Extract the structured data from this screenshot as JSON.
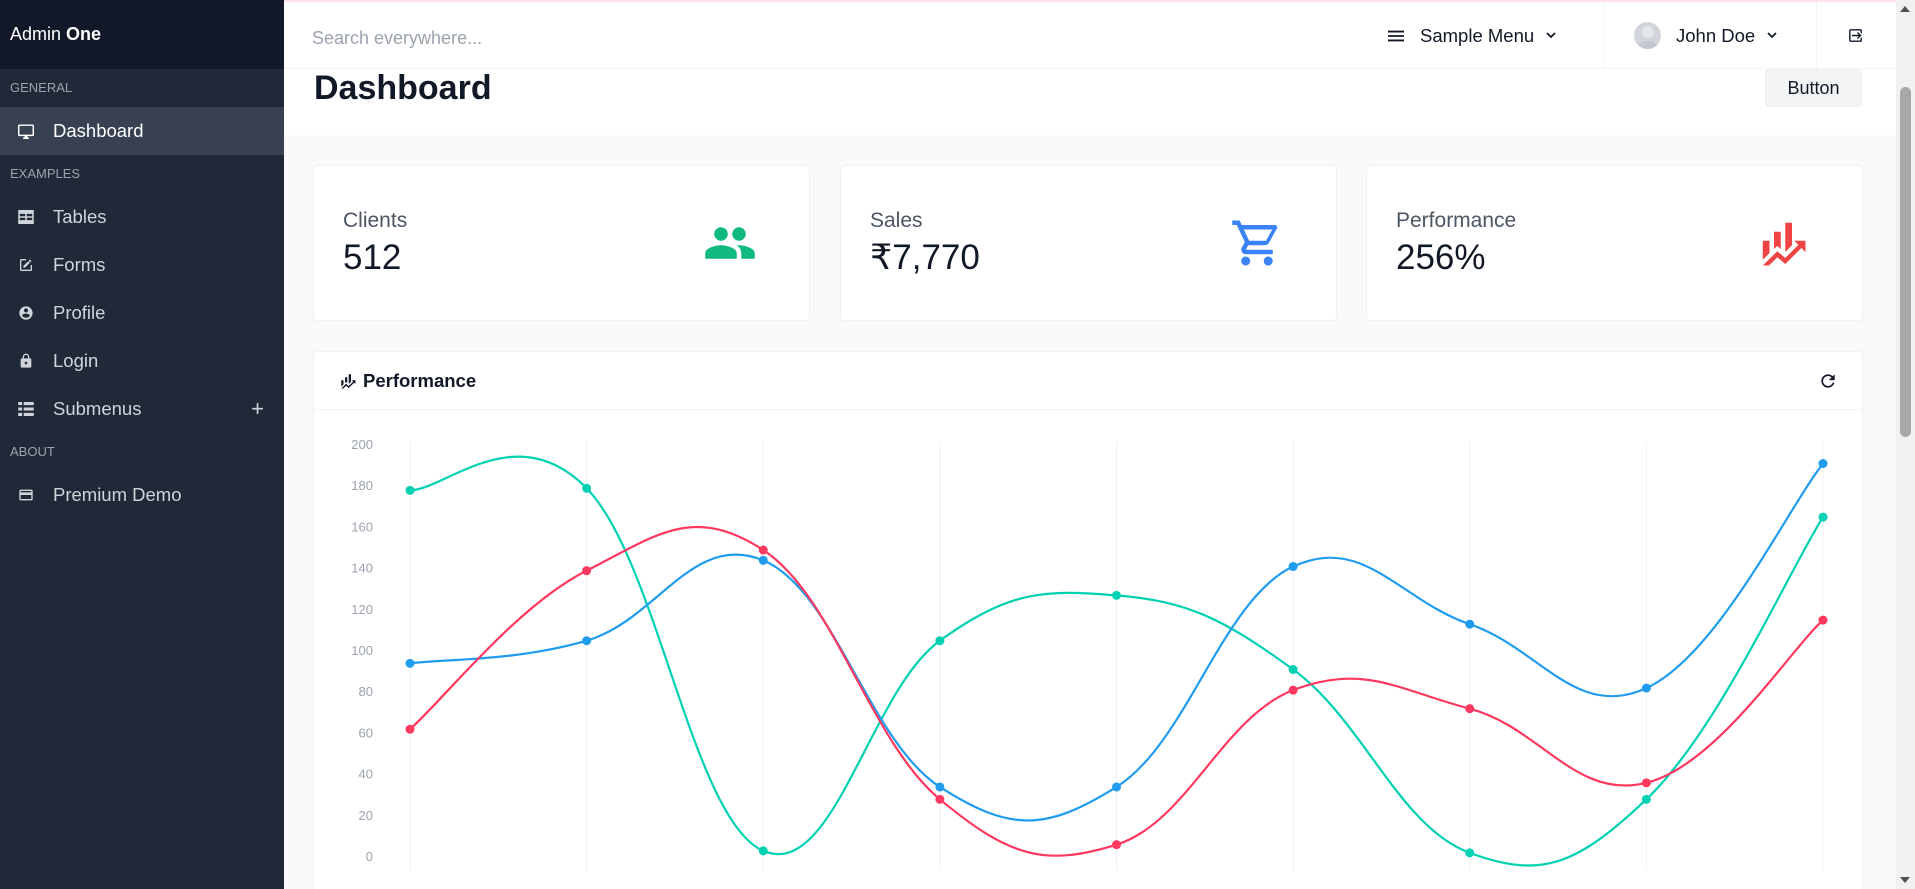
{
  "sidebar": {
    "brand_prefix": "Admin",
    "brand_bold": "One",
    "sections": [
      {
        "label": "GENERAL",
        "items": [
          {
            "label": "Dashboard",
            "icon": "monitor-icon",
            "active": true
          }
        ]
      },
      {
        "label": "EXAMPLES",
        "items": [
          {
            "label": "Tables",
            "icon": "table-icon"
          },
          {
            "label": "Forms",
            "icon": "edit-square-icon"
          },
          {
            "label": "Profile",
            "icon": "account-circle-icon"
          },
          {
            "label": "Login",
            "icon": "lock-icon"
          },
          {
            "label": "Submenus",
            "icon": "view-list-icon",
            "expand": "+"
          }
        ]
      },
      {
        "label": "ABOUT",
        "items": [
          {
            "label": "Premium Demo",
            "icon": "credit-card-icon"
          }
        ]
      }
    ]
  },
  "topbar": {
    "search_placeholder": "Search everywhere...",
    "menu_label": "Sample Menu",
    "user_name": "John Doe"
  },
  "page": {
    "title": "Dashboard",
    "button_label": "Button"
  },
  "cards": [
    {
      "label": "Clients",
      "value": "512",
      "icon": "account-multiple-icon",
      "color": "#10b981"
    },
    {
      "label": "Sales",
      "value": "₹7,770",
      "icon": "cart-outline-icon",
      "color": "#3b82f6"
    },
    {
      "label": "Performance",
      "value": "256%",
      "icon": "finance-icon",
      "color": "#ef4444"
    }
  ],
  "chart_panel": {
    "title": "Performance",
    "icon": "finance-icon"
  },
  "chart_data": {
    "type": "line",
    "ylim": [
      0,
      200
    ],
    "yticks": [
      0,
      20,
      40,
      60,
      80,
      100,
      120,
      140,
      160,
      180,
      200
    ],
    "x": [
      0,
      1,
      2,
      3,
      4,
      5,
      6,
      7,
      8
    ],
    "grid": "vertical",
    "series": [
      {
        "color": "#00d1b2",
        "values": [
          178,
          179,
          3,
          105,
          127,
          91,
          2,
          28,
          165
        ]
      },
      {
        "color": "#209cee",
        "values": [
          94,
          105,
          144,
          34,
          34,
          141,
          113,
          82,
          191
        ]
      },
      {
        "color": "#ff3860",
        "values": [
          62,
          139,
          149,
          28,
          6,
          81,
          72,
          36,
          115
        ]
      }
    ]
  }
}
